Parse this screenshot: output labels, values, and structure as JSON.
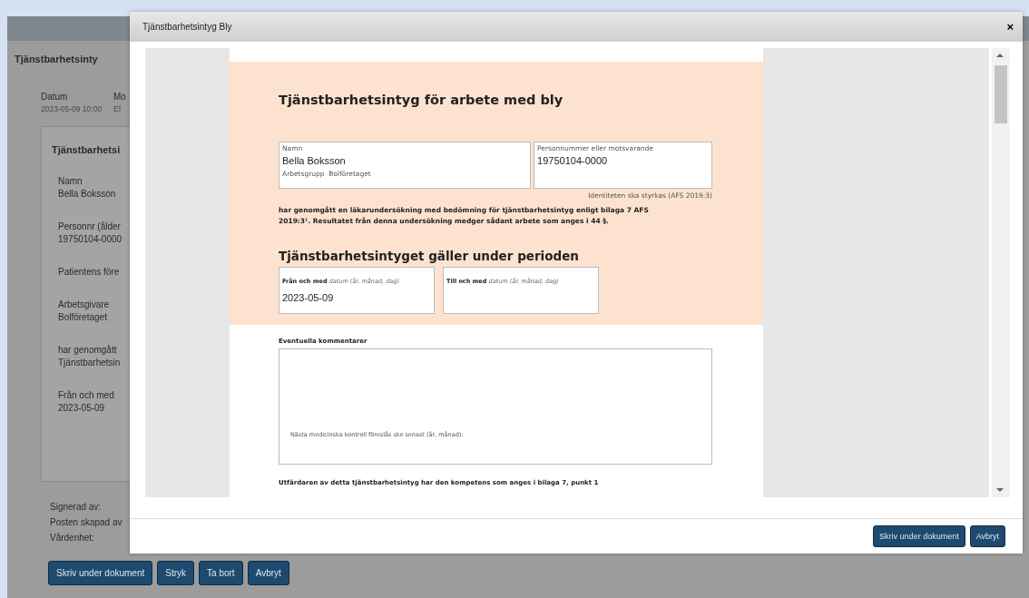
{
  "background": {
    "title": "Tjänstbarhetsinty",
    "meta": [
      {
        "label": "Datum",
        "value": "2023-05-09 10:00"
      },
      {
        "label": "Mo",
        "value": "Ef"
      }
    ],
    "card": {
      "title": "Tjänstbarhetsi",
      "fields": [
        {
          "label": "Namn",
          "value": "Bella Boksson"
        },
        {
          "label": "Personnr (ålder",
          "value": "19750104-0000"
        },
        {
          "label": "Patientens före"
        },
        {
          "label": "Arbetsgivare",
          "value": "Bolföretaget"
        },
        {
          "label": "har genomgått",
          "value": "Tjänstbarhetsin"
        },
        {
          "label": "Från och med",
          "value": "2023-05-09"
        }
      ]
    },
    "footer_labels": [
      "Signerad av:",
      "Posten skapad av",
      "Vårdenhet:"
    ],
    "buttons": [
      "Skriv under dokument",
      "Stryk",
      "Ta bort",
      "Avbryt"
    ]
  },
  "dialog": {
    "title": "Tjänstbarhetsintyg Bly",
    "close": "×",
    "document": {
      "title": "Tjänstbarhetsintyg för arbete med bly",
      "name_label": "Namn",
      "name": "Bella Boksson",
      "group_label": "Arbetsgrupp",
      "group": "Bolföretaget",
      "pnr_label": "Personnummer eller motsvarande",
      "pnr": "19750104-0000",
      "id_note": "Identiteten ska styrkas (AFS 2019:3)",
      "statement": "har genomgått en läkarundersökning med bedömning för tjänstbarhetsintyg enligt bilaga 7 AFS 2019:3¹. Resultatet från denna undersökning medger sådant arbete som anges i 44 §.",
      "period_heading": "Tjänstbarhetsintyget gäller under perioden",
      "period": [
        {
          "label": "Från och med",
          "hint": "datum (år, månad, dag)",
          "value": "2023-05-09"
        },
        {
          "label": "Till och med",
          "hint": "datum (år, månad, dag)"
        }
      ],
      "comments_label": "Eventuella kommentarer",
      "next_control": "Nästa medicinska kontroll föreslås ske senast (år, månad):",
      "issuer": "Utfärdaren av detta tjänstbarhetsintyg har den kompetens som anges i bilaga 7, punkt 1"
    },
    "buttons": [
      "Skriv under dokument",
      "Avbryt"
    ]
  }
}
